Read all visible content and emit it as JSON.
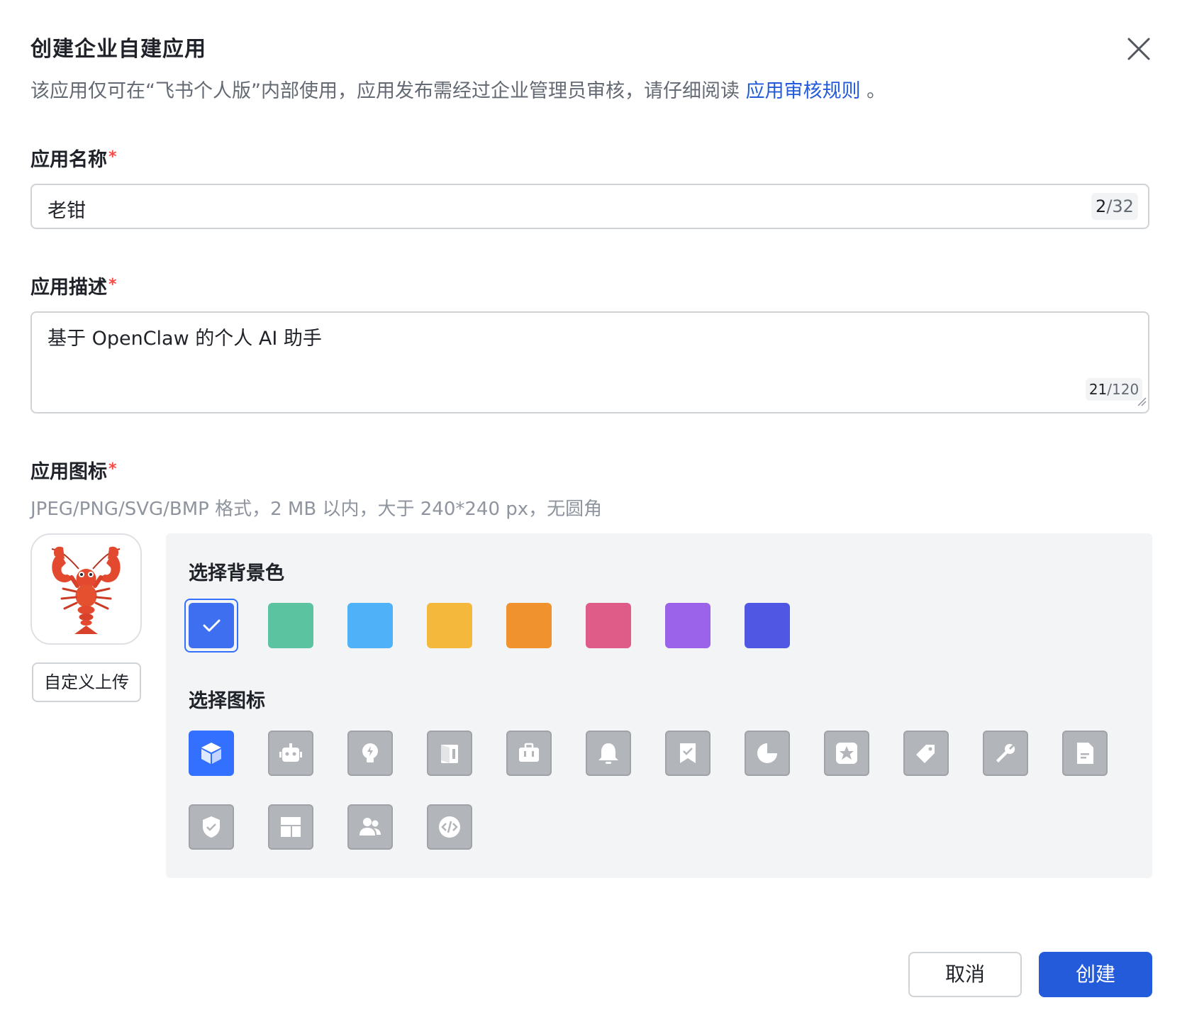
{
  "dialog": {
    "title": "创建企业自建应用",
    "subtitle_text": "该应用仅可在“飞书个人版”内部使用，应用发布需经过企业管理员审核，请仔细阅读",
    "subtitle_link": "应用审核规则",
    "subtitle_end": " 。"
  },
  "name_field": {
    "label": "应用名称",
    "required_mark": "*",
    "value": "老钳",
    "counter_current": "2",
    "counter_max": "/32"
  },
  "desc_field": {
    "label": "应用描述",
    "required_mark": "*",
    "value": "基于 OpenClaw 的个人 AI 助手",
    "counter_current": "21",
    "counter_max": "/120"
  },
  "icon_field": {
    "label": "应用图标",
    "required_mark": "*",
    "hint": "JPEG/PNG/SVG/BMP 格式，2 MB 以内，大于 240*240 px，无圆角",
    "preview_icon": "lobster-emoji-icon",
    "upload_label": "自定义上传"
  },
  "picker": {
    "bg_label": "选择背景色",
    "icon_label": "选择图标",
    "colors": [
      "#3d6ff0",
      "#5cc3a0",
      "#4fb1f7",
      "#f3b83c",
      "#f0932f",
      "#df5b88",
      "#9a63ea",
      "#5058e3"
    ],
    "selected_color_index": 0,
    "icons": [
      "cube-icon",
      "robot-icon",
      "lightbulb-icon",
      "book-icon",
      "briefcase-icon",
      "bell-icon",
      "bookmark-check-icon",
      "pie-chart-icon",
      "star-icon",
      "tag-icon",
      "wrench-icon",
      "document-icon",
      "shield-check-icon",
      "layout-icon",
      "users-icon",
      "code-icon"
    ],
    "selected_icon_index": 0
  },
  "footer": {
    "cancel_label": "取消",
    "create_label": "创建"
  }
}
